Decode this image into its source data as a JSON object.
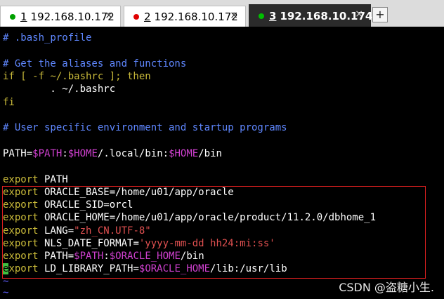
{
  "tabs": [
    {
      "num": "1",
      "label": "192.168.10.172",
      "dot_color": "#00a000"
    },
    {
      "num": "2",
      "label": "192.168.10.172",
      "dot_color": "#e00000"
    },
    {
      "num": "3",
      "label": "192.168.10.174",
      "dot_color": "#00c000"
    }
  ],
  "add_tab_label": "+",
  "close_glyph": "×",
  "lines": {
    "l1": "# .bash_profile",
    "l2": "# Get the aliases and functions",
    "l3": "if [ -f ~/.bashrc ]; then",
    "l4": "        . ~/.bashrc",
    "l5": "fi",
    "l6": "# User specific environment and startup programs",
    "l7a": "PATH=",
    "l7b": "$PATH",
    "l7c": ":",
    "l7d": "$HOME",
    "l7e": "/.local/bin:",
    "l7f": "$HOME",
    "l7g": "/bin",
    "l8a": "export",
    "l8b": " PATH",
    "l9a": "export",
    "l9b": " ORACLE_BASE=/home/u01/app/oracle",
    "l10a": "export",
    "l10b": " ORACLE_SID=orcl",
    "l11a": "export",
    "l11b": " ORACLE_HOME=/home/u01/app/oracle/product/11.2.0/dbhome_1",
    "l12a": "export",
    "l12b": " LANG=",
    "l12c": "\"zh_CN.UTF-8\"",
    "l13a": "export",
    "l13b": " NLS_DATE_FORMAT=",
    "l13c": "'yyyy-mm-dd hh24:mi:ss'",
    "l14a": "export",
    "l14b": " PATH=",
    "l14c": "$PATH",
    "l14d": ":",
    "l14e": "$ORACLE_HOME",
    "l14f": "/bin",
    "l15cursor": "e",
    "l15a": "xport",
    "l15b": " LD_LIBRARY_PATH=",
    "l15c": "$ORACLE_HOME",
    "l15d": "/lib:/usr/lib",
    "tilde": "~"
  },
  "watermark": "CSDN @盗糖小生."
}
